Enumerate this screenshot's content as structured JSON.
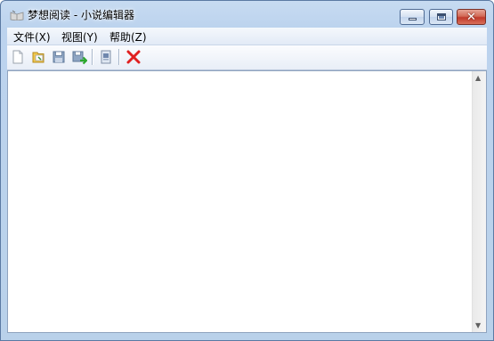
{
  "window": {
    "title": "梦想阅读 - 小说编辑器",
    "app_icon": "book-icon"
  },
  "caption_buttons": {
    "minimize_icon": "minimize-icon",
    "maximize_icon": "maximize-icon",
    "close_icon": "close-icon",
    "close_glyph": "✕"
  },
  "menu": {
    "items": [
      {
        "label": "文件(X)"
      },
      {
        "label": "视图(Y)"
      },
      {
        "label": "帮助(Z)"
      }
    ]
  },
  "toolbar": {
    "buttons": [
      {
        "icon": "new-document-icon"
      },
      {
        "icon": "open-folder-icon"
      },
      {
        "icon": "save-icon"
      },
      {
        "icon": "save-as-icon"
      },
      {
        "icon": "properties-icon"
      },
      {
        "icon": "delete-icon"
      }
    ]
  },
  "editor": {
    "value": "",
    "scroll_up_glyph": "▲",
    "scroll_down_glyph": "▼"
  },
  "colors": {
    "delete_red": "#e02020",
    "save_green": "#2da82d"
  }
}
